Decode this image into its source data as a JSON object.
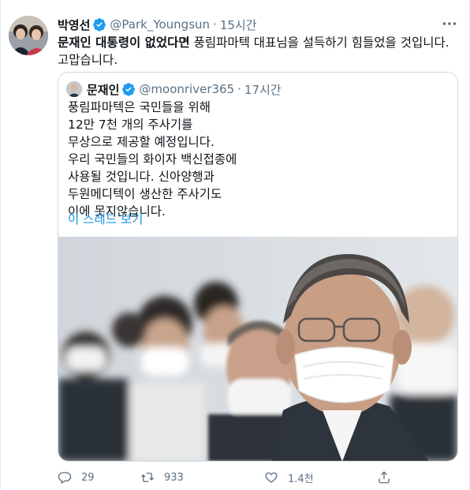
{
  "tweet": {
    "author_name": "박영선",
    "author_handle": "@Park_Youngsun",
    "separator": "·",
    "time": "15시간",
    "text_bold": "문재인 대통령이 없었다면",
    "text_rest": " 풍림파마텍 대표님을 설득하기 힘들었을 것입니다. 고맙습니다."
  },
  "quote": {
    "author_name": "문재인",
    "author_handle": "@moonriver365",
    "separator": "·",
    "time": "17시간",
    "lines": [
      "풍림파마텍은 국민들을 위해",
      "12만 7천 개의 주사기를",
      "무상으로 제공할 예정입니다.",
      "우리 국민들의 화이자 백신접종에",
      "사용될 것입니다. 신아양행과",
      "두원메디텍이 생산한 주사기도",
      "이에 못지않습니다."
    ],
    "thread_link": "이 스레드 보기"
  },
  "actions": {
    "reply_count": "29",
    "retweet_count": "933",
    "like_count": "1.4천"
  },
  "colors": {
    "accent": "#1b95e0",
    "secondary_text": "#5b7083",
    "verified": "#1d9bf0",
    "border": "#cfd9de"
  },
  "icons": [
    "more-icon",
    "verified-icon",
    "reply-icon",
    "retweet-icon",
    "like-icon",
    "share-icon"
  ]
}
